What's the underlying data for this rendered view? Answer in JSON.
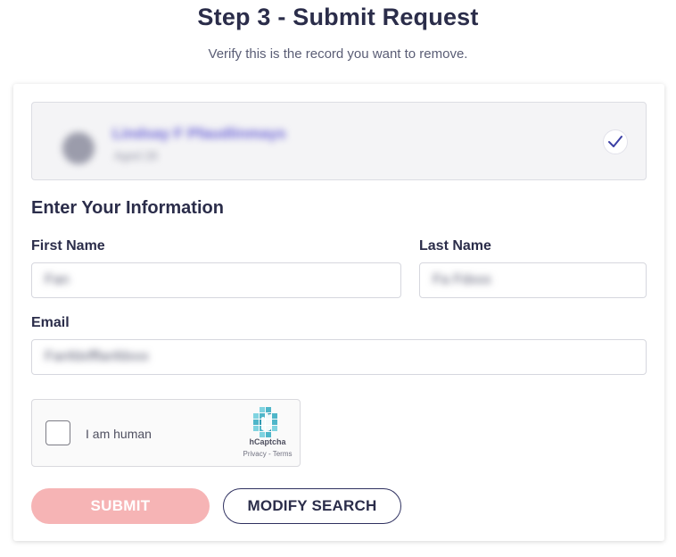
{
  "header": {
    "title": "Step 3 - Submit Request",
    "subtitle": "Verify this is the record you want to remove."
  },
  "record": {
    "name": "Lindsay F Pfaudlinmays",
    "detail": "Aged 28",
    "selected": true
  },
  "form": {
    "section_title": "Enter Your Information",
    "first_name": {
      "label": "First Name",
      "value": "Fan"
    },
    "last_name": {
      "label": "Last Name",
      "value": "Fa Fdxxx"
    },
    "email": {
      "label": "Email",
      "value": "Fanfdxfffanfdxxx"
    }
  },
  "captcha": {
    "label": "I am human",
    "brand": "hCaptcha",
    "links": "Privacy - Terms"
  },
  "buttons": {
    "submit_label": "SUBMIT",
    "modify_label": "MODIFY SEARCH"
  },
  "colors": {
    "accent": "#2b2d4a",
    "submit_disabled": "#f6b4b5",
    "check": "#3b3fa5",
    "captcha_brand": "#4fb6c9"
  }
}
